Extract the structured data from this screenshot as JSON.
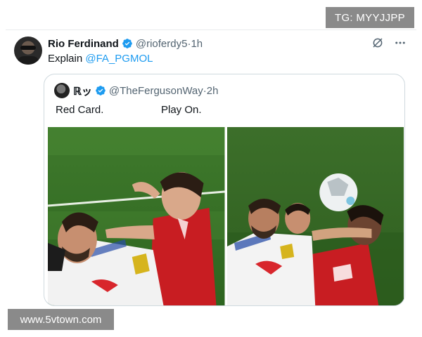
{
  "watermarks": {
    "top": "TG: MYYJJPP",
    "bottom": "www.5vtown.com"
  },
  "tweet": {
    "author_name": "Rio Ferdinand",
    "handle": "@rioferdy5",
    "separator": " · ",
    "time": "1h",
    "text_prefix": "Explain ",
    "mention": "@FA_PGMOL",
    "icons": [
      "verified-badge-icon",
      "grok-icon",
      "more-icon"
    ]
  },
  "quoted_tweet": {
    "author_name": "ℝッ",
    "handle": "@TheFergusonWay",
    "separator": " · ",
    "time": "2h",
    "caption_left": "Red Card.",
    "caption_right": "Play On."
  },
  "colors": {
    "link": "#1d9bf0",
    "secondary_text": "#536471",
    "border": "#cfd9de"
  }
}
